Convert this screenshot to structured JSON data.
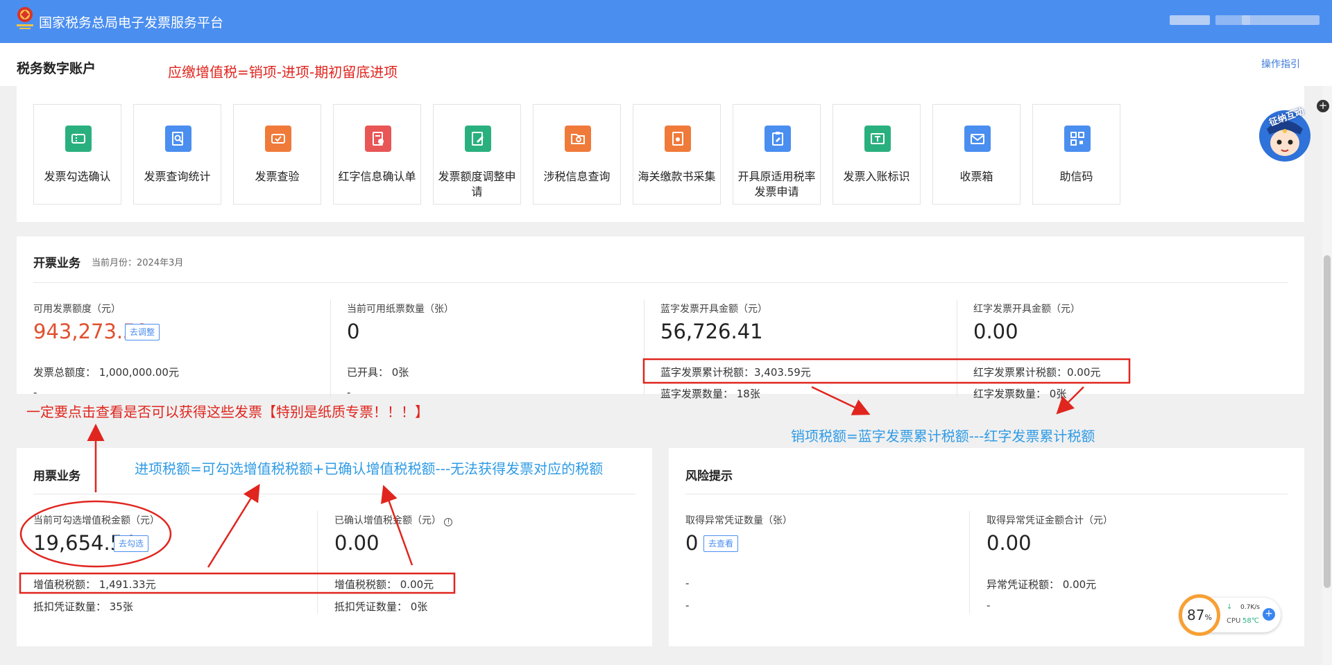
{
  "app": {
    "title": "国家税务总局电子发票服务平台"
  },
  "header": {
    "page_title": "税务数字账户",
    "help_link": "操作指引"
  },
  "tiles": [
    {
      "label": "发票勾选确认",
      "icon": "ticket-icon",
      "color": "#2ab07f"
    },
    {
      "label": "发票查询统计",
      "icon": "search-doc-icon",
      "color": "#4a8ef0"
    },
    {
      "label": "发票查验",
      "icon": "verify-ticket-icon",
      "color": "#f07a3a"
    },
    {
      "label": "红字信息确认单",
      "icon": "red-doc-icon",
      "color": "#e85656"
    },
    {
      "label": "发票额度调整申请",
      "icon": "edit-doc-icon",
      "color": "#2ab07f"
    },
    {
      "label": "涉税信息查询",
      "icon": "folder-search-icon",
      "color": "#f07a3a"
    },
    {
      "label": "海关缴款书采集",
      "icon": "customs-doc-icon",
      "color": "#f07a3a"
    },
    {
      "label": "开具原适用税率发票申请",
      "icon": "clipboard-edit-icon",
      "color": "#4a8ef0"
    },
    {
      "label": "发票入账标识",
      "icon": "stamp-ticket-icon",
      "color": "#2ab07f"
    },
    {
      "label": "收票箱",
      "icon": "mail-icon",
      "color": "#4a8ef0"
    },
    {
      "label": "助信码",
      "icon": "qrcode-icon",
      "color": "#4a8ef0"
    }
  ],
  "invoicing": {
    "title": "开票业务",
    "month_label": "当前月份：2024年3月",
    "col1": {
      "label": "可用发票额度（元）",
      "value": "943,273.59",
      "button": "去调整",
      "line1": "发票总额度：  1,000,000.00元",
      "line2": "-"
    },
    "col2": {
      "label": "当前可用纸票数量（张）",
      "value": "0",
      "line1": "已开具：  0张",
      "line2": "-"
    },
    "col3": {
      "label": "蓝字发票开具金额（元）",
      "value": "56,726.41",
      "line1": "蓝字发票累计税额：3,403.59元",
      "line2": "蓝字发票数量：  18张"
    },
    "col4": {
      "label": "红字发票开具金额（元）",
      "value": "0.00",
      "line1": "红字发票累计税额：0.00元",
      "line2": "红字发票数量：  0张"
    }
  },
  "usage": {
    "title": "用票业务",
    "col1": {
      "label": "当前可勾选增值税金额（元）",
      "value": "19,654.54",
      "button": "去勾选",
      "line1": "增值税税额：  1,491.33元",
      "line2": "抵扣凭证数量：  35张"
    },
    "col2": {
      "label": "已确认增值税金额（元）",
      "value": "0.00",
      "line1": "增值税税额：  0.00元",
      "line2": "抵扣凭证数量：  0张"
    }
  },
  "risk": {
    "title": "风险提示",
    "col1": {
      "label": "取得异常凭证数量（张）",
      "value": "0",
      "button": "去查看",
      "line1": "-",
      "line2": "-"
    },
    "col2": {
      "label": "取得异常凭证金额合计（元）",
      "value": "0.00",
      "line1": "异常凭证税额：  0.00元",
      "line2": "-"
    }
  },
  "annotations": {
    "formula_payable": "应缴增值税=销项-进项-期初留底进项",
    "note_check": "一定要点击查看是否可以获得这些发票【特别是纸质专票！！！】",
    "formula_output": "销项税额=蓝字发票累计税额---红字发票累计税额",
    "formula_input": "进项税额=可勾选增值税税额+已确认增值税税额---无法获得发票对应的税额"
  },
  "assistant": {
    "text": "征纳互动"
  },
  "monitor": {
    "percent": "87",
    "percent_unit": "%",
    "speed": "0.7K/s",
    "cpu_label": "CPU",
    "cpu_temp": "58℃"
  },
  "colors": {
    "header_blue": "#4a8ef0",
    "annotation_red": "#e0251e",
    "annotation_blue": "#2f9be6",
    "amount_red": "#e0502f"
  }
}
